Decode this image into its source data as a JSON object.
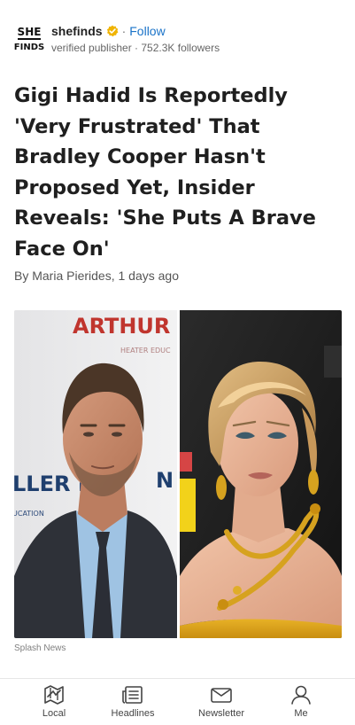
{
  "publisher": {
    "logo_text_top": "SHE",
    "logo_text_bottom": "FINDS",
    "name": "shefinds",
    "verified_icon": "verified-badge-icon",
    "separator": "·",
    "follow_label": "Follow",
    "meta": "verified publisher · 752.3K followers"
  },
  "article": {
    "headline": "Gigi Hadid Is Reportedly 'Very Frustrated' That Bradley Cooper Hasn't Proposed Yet, Insider Reveals: 'She Puts A Brave Face On'",
    "byline": "By Maria Pierides, 1 days ago",
    "image": {
      "left_backdrop_text_top": "ARTHUR MIL",
      "left_backdrop_text_sub": "HEATER EDUC",
      "left_backdrop_text_mid": "LLER F",
      "left_backdrop_text_mid2": "N",
      "left_backdrop_text_low": "UCATION"
    },
    "image_credit": "Splash News"
  },
  "bottom_nav": [
    {
      "label": "Local",
      "icon": "map-icon"
    },
    {
      "label": "Headlines",
      "icon": "newspaper-icon"
    },
    {
      "label": "Newsletter",
      "icon": "envelope-icon"
    },
    {
      "label": "Me",
      "icon": "person-icon"
    }
  ],
  "colors": {
    "accent": "#1a73c8",
    "verified": "#f0b400",
    "headline": "#1f1f1f"
  }
}
